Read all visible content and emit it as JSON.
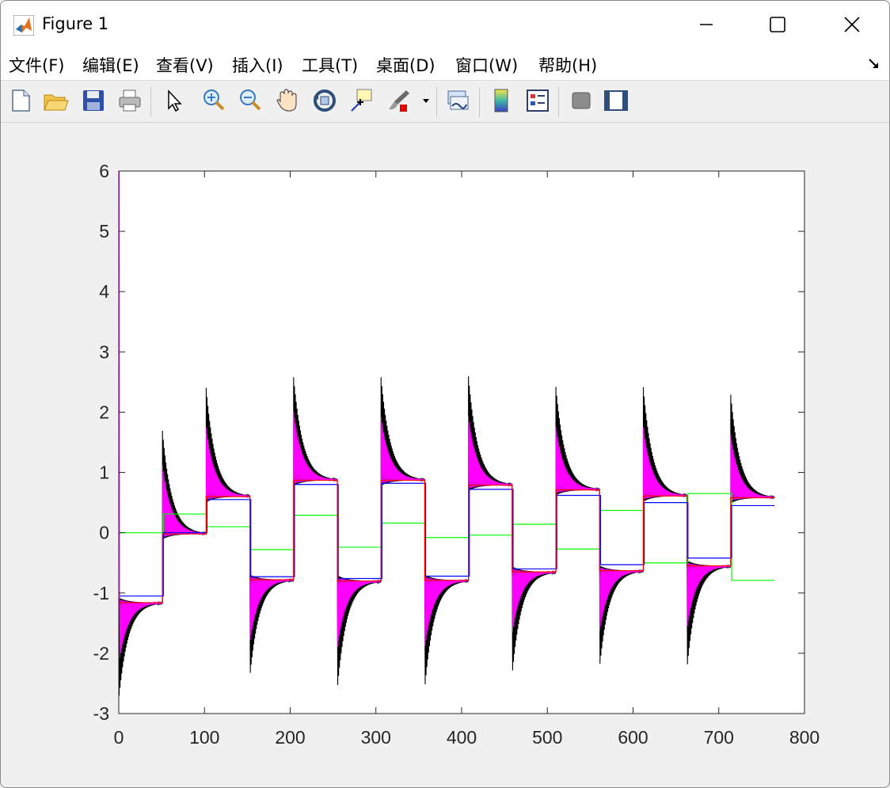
{
  "window": {
    "title": "Figure 1",
    "menus": [
      "文件(F)",
      "编辑(E)",
      "查看(V)",
      "插入(I)",
      "工具(T)",
      "桌面(D)",
      "窗口(W)",
      "帮助(H)"
    ],
    "toolbar_icons": [
      "new-figure-icon",
      "open-file-icon",
      "save-icon",
      "print-icon",
      "pointer-icon",
      "zoom-in-icon",
      "zoom-out-icon",
      "pan-icon",
      "rotate-3d-icon",
      "data-cursor-icon",
      "brush-icon",
      "link-plot-icon",
      "colorbar-icon",
      "legend-icon",
      "hide-plot-tools-icon",
      "show-plot-tools-icon"
    ]
  },
  "chart_data": {
    "type": "line",
    "title": "",
    "xlabel": "",
    "ylabel": "",
    "xlim": [
      0,
      800
    ],
    "ylim": [
      -3,
      6
    ],
    "xticks": [
      "0",
      "100",
      "200",
      "300",
      "400",
      "500",
      "600",
      "700",
      "800"
    ],
    "yticks": [
      "6",
      "5",
      "4",
      "3",
      "2",
      "1",
      "0",
      "-1",
      "-2",
      "-3"
    ],
    "grid": false,
    "segment_starts": [
      0,
      51,
      102,
      153,
      204,
      255,
      306,
      357,
      408,
      459,
      510,
      561,
      612,
      663,
      714,
      765
    ],
    "series": [
      {
        "color": "#00ff00",
        "style": "step",
        "values": [
          0.0,
          0.31,
          0.1,
          -0.28,
          0.29,
          -0.24,
          0.16,
          -0.08,
          -0.04,
          0.14,
          -0.27,
          0.37,
          -0.5,
          0.65,
          -0.79
        ]
      },
      {
        "color": "#0000ff",
        "style": "step",
        "values": [
          -1.05,
          0.0,
          0.55,
          -0.73,
          0.8,
          -0.76,
          0.82,
          -0.72,
          0.72,
          -0.6,
          0.62,
          -0.53,
          0.5,
          -0.42,
          0.45
        ]
      },
      {
        "color": "#ff0000",
        "style": "step",
        "values": [
          -1.16,
          -0.02,
          0.6,
          -0.78,
          0.87,
          -0.8,
          0.87,
          -0.79,
          0.79,
          -0.65,
          0.71,
          -0.63,
          0.61,
          -0.55,
          0.58
        ]
      },
      {
        "color": "#000000",
        "style": "oscillation",
        "amplitude": [
          0.85,
          0.9,
          0.95,
          0.85,
          0.9,
          0.95,
          0.9,
          0.95,
          0.95,
          0.9,
          0.9,
          0.85,
          0.95,
          0.9,
          0.9
        ]
      },
      {
        "color": "#ff00ff",
        "style": "oscillation",
        "amplitude": [
          0.55,
          0.6,
          0.6,
          0.55,
          0.6,
          0.6,
          0.55,
          0.6,
          0.6,
          0.55,
          0.55,
          0.55,
          0.6,
          0.55,
          0.55
        ],
        "initial_spike": 6.0
      }
    ]
  }
}
